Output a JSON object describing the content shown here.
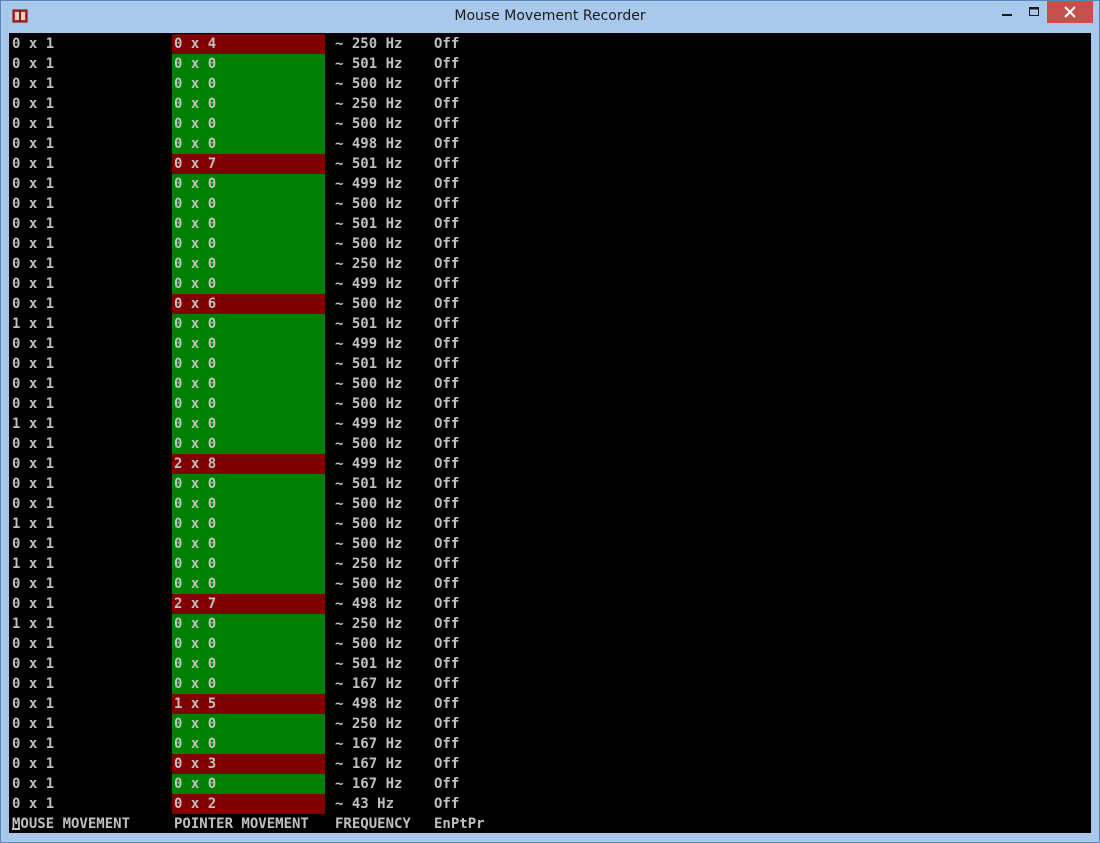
{
  "window": {
    "title": "Mouse Movement Recorder"
  },
  "rows": [
    {
      "mouse": "0 x 1",
      "pointer": "0 x 4",
      "freq": "~ 250 Hz",
      "flag": "Off",
      "state": "red"
    },
    {
      "mouse": "0 x 1",
      "pointer": "0 x 0",
      "freq": "~ 501 Hz",
      "flag": "Off",
      "state": "green"
    },
    {
      "mouse": "0 x 1",
      "pointer": "0 x 0",
      "freq": "~ 500 Hz",
      "flag": "Off",
      "state": "green"
    },
    {
      "mouse": "0 x 1",
      "pointer": "0 x 0",
      "freq": "~ 250 Hz",
      "flag": "Off",
      "state": "green"
    },
    {
      "mouse": "0 x 1",
      "pointer": "0 x 0",
      "freq": "~ 500 Hz",
      "flag": "Off",
      "state": "green"
    },
    {
      "mouse": "0 x 1",
      "pointer": "0 x 0",
      "freq": "~ 498 Hz",
      "flag": "Off",
      "state": "green"
    },
    {
      "mouse": "0 x 1",
      "pointer": "0 x 7",
      "freq": "~ 501 Hz",
      "flag": "Off",
      "state": "red"
    },
    {
      "mouse": "0 x 1",
      "pointer": "0 x 0",
      "freq": "~ 499 Hz",
      "flag": "Off",
      "state": "green"
    },
    {
      "mouse": "0 x 1",
      "pointer": "0 x 0",
      "freq": "~ 500 Hz",
      "flag": "Off",
      "state": "green"
    },
    {
      "mouse": "0 x 1",
      "pointer": "0 x 0",
      "freq": "~ 501 Hz",
      "flag": "Off",
      "state": "green"
    },
    {
      "mouse": "0 x 1",
      "pointer": "0 x 0",
      "freq": "~ 500 Hz",
      "flag": "Off",
      "state": "green"
    },
    {
      "mouse": "0 x 1",
      "pointer": "0 x 0",
      "freq": "~ 250 Hz",
      "flag": "Off",
      "state": "green"
    },
    {
      "mouse": "0 x 1",
      "pointer": "0 x 0",
      "freq": "~ 499 Hz",
      "flag": "Off",
      "state": "green"
    },
    {
      "mouse": "0 x 1",
      "pointer": "0 x 6",
      "freq": "~ 500 Hz",
      "flag": "Off",
      "state": "red"
    },
    {
      "mouse": "1 x 1",
      "pointer": "0 x 0",
      "freq": "~ 501 Hz",
      "flag": "Off",
      "state": "green"
    },
    {
      "mouse": "0 x 1",
      "pointer": "0 x 0",
      "freq": "~ 499 Hz",
      "flag": "Off",
      "state": "green"
    },
    {
      "mouse": "0 x 1",
      "pointer": "0 x 0",
      "freq": "~ 501 Hz",
      "flag": "Off",
      "state": "green"
    },
    {
      "mouse": "0 x 1",
      "pointer": "0 x 0",
      "freq": "~ 500 Hz",
      "flag": "Off",
      "state": "green"
    },
    {
      "mouse": "0 x 1",
      "pointer": "0 x 0",
      "freq": "~ 500 Hz",
      "flag": "Off",
      "state": "green"
    },
    {
      "mouse": "1 x 1",
      "pointer": "0 x 0",
      "freq": "~ 499 Hz",
      "flag": "Off",
      "state": "green"
    },
    {
      "mouse": "0 x 1",
      "pointer": "0 x 0",
      "freq": "~ 500 Hz",
      "flag": "Off",
      "state": "green"
    },
    {
      "mouse": "0 x 1",
      "pointer": "2 x 8",
      "freq": "~ 499 Hz",
      "flag": "Off",
      "state": "red"
    },
    {
      "mouse": "0 x 1",
      "pointer": "0 x 0",
      "freq": "~ 501 Hz",
      "flag": "Off",
      "state": "green"
    },
    {
      "mouse": "0 x 1",
      "pointer": "0 x 0",
      "freq": "~ 500 Hz",
      "flag": "Off",
      "state": "green"
    },
    {
      "mouse": "1 x 1",
      "pointer": "0 x 0",
      "freq": "~ 500 Hz",
      "flag": "Off",
      "state": "green"
    },
    {
      "mouse": "0 x 1",
      "pointer": "0 x 0",
      "freq": "~ 500 Hz",
      "flag": "Off",
      "state": "green"
    },
    {
      "mouse": "1 x 1",
      "pointer": "0 x 0",
      "freq": "~ 250 Hz",
      "flag": "Off",
      "state": "green"
    },
    {
      "mouse": "0 x 1",
      "pointer": "0 x 0",
      "freq": "~ 500 Hz",
      "flag": "Off",
      "state": "green"
    },
    {
      "mouse": "0 x 1",
      "pointer": "2 x 7",
      "freq": "~ 498 Hz",
      "flag": "Off",
      "state": "red"
    },
    {
      "mouse": "1 x 1",
      "pointer": "0 x 0",
      "freq": "~ 250 Hz",
      "flag": "Off",
      "state": "green"
    },
    {
      "mouse": "0 x 1",
      "pointer": "0 x 0",
      "freq": "~ 500 Hz",
      "flag": "Off",
      "state": "green"
    },
    {
      "mouse": "0 x 1",
      "pointer": "0 x 0",
      "freq": "~ 501 Hz",
      "flag": "Off",
      "state": "green"
    },
    {
      "mouse": "0 x 1",
      "pointer": "0 x 0",
      "freq": "~ 167 Hz",
      "flag": "Off",
      "state": "green"
    },
    {
      "mouse": "0 x 1",
      "pointer": "1 x 5",
      "freq": "~ 498 Hz",
      "flag": "Off",
      "state": "red"
    },
    {
      "mouse": "0 x 1",
      "pointer": "0 x 0",
      "freq": "~ 250 Hz",
      "flag": "Off",
      "state": "green"
    },
    {
      "mouse": "0 x 1",
      "pointer": "0 x 0",
      "freq": "~ 167 Hz",
      "flag": "Off",
      "state": "green"
    },
    {
      "mouse": "0 x 1",
      "pointer": "0 x 3",
      "freq": "~ 167 Hz",
      "flag": "Off",
      "state": "red"
    },
    {
      "mouse": "0 x 1",
      "pointer": "0 x 0",
      "freq": "~ 167 Hz",
      "flag": "Off",
      "state": "green"
    },
    {
      "mouse": "0 x 1",
      "pointer": "0 x 2",
      "freq": "~ 43 Hz",
      "flag": "Off",
      "state": "red"
    }
  ],
  "header": {
    "mouse": "MOUSE MOVEMENT",
    "pointer": "POINTER MOVEMENT",
    "freq": "FREQUENCY",
    "flag": "EnPtPr"
  },
  "colors": {
    "ok": "#008000",
    "moved": "#800000",
    "text": "#c0c0c0",
    "background": "#000000"
  }
}
